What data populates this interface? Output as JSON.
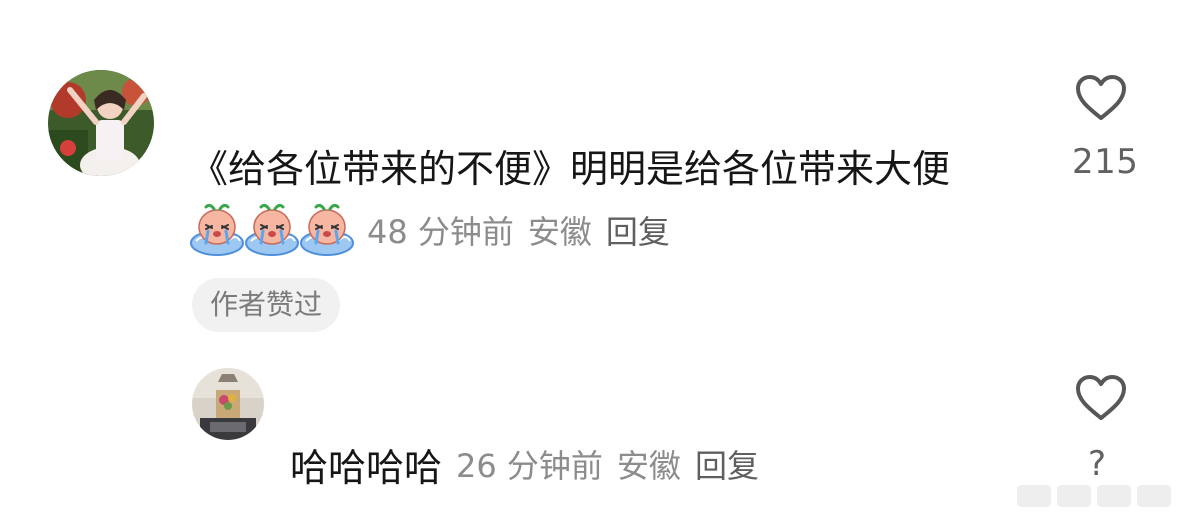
{
  "comment": {
    "text": "《给各位带来的不便》明明是给各位带来大便",
    "emoji_name": "crying-face-sticker",
    "emoji_count": 3,
    "time": "48 分钟前",
    "location": "安徽",
    "reply_label": "回复",
    "like_count": "215",
    "author_badge": "作者赞过"
  },
  "reply": {
    "text": "哈哈哈哈",
    "time": "26 分钟前",
    "location": "安徽",
    "reply_label": "回复",
    "like_count": "?"
  },
  "colors": {
    "text_primary": "#161616",
    "text_secondary": "#8c8c8c",
    "icon_outline": "#575757",
    "badge_bg": "#f1f1f1"
  }
}
